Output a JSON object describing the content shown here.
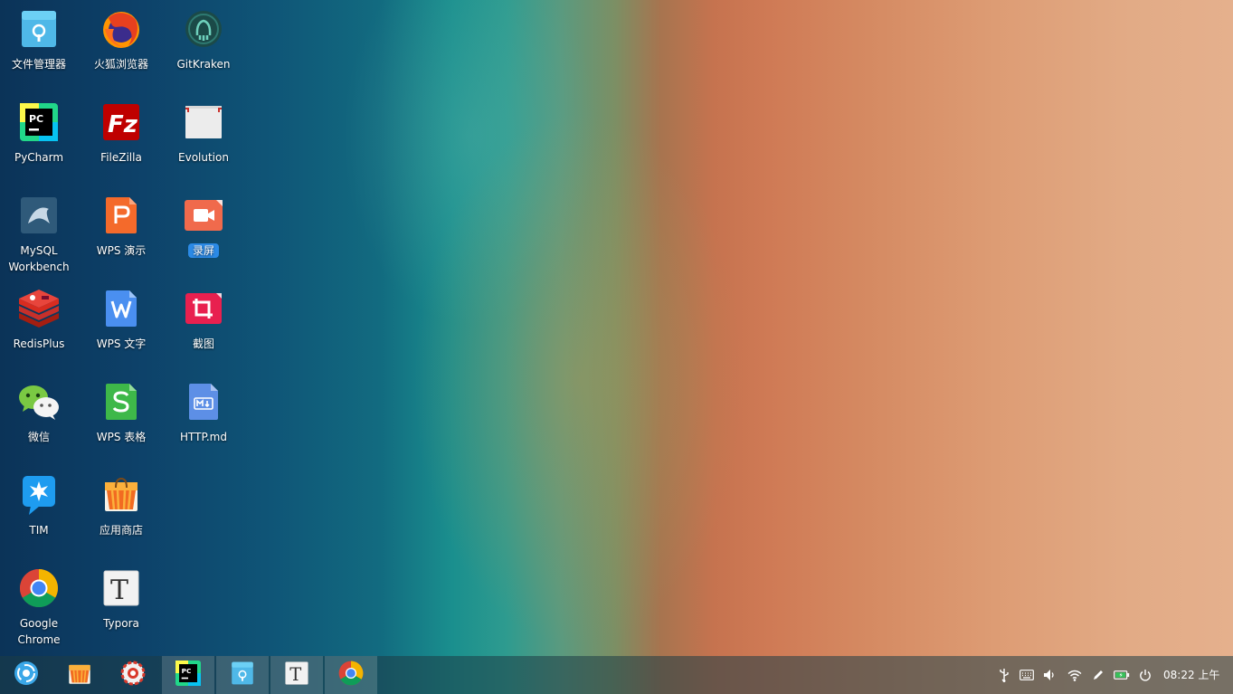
{
  "desktop": {
    "icons": [
      {
        "label": "文件管理器",
        "icon": "file-manager-icon"
      },
      {
        "label": "PyCharm",
        "icon": "pycharm-icon"
      },
      {
        "label": "MySQL Workbench",
        "icon": "mysql-workbench-icon"
      },
      {
        "label": "RedisPlus",
        "icon": "redisplus-icon"
      },
      {
        "label": "微信",
        "icon": "wechat-icon"
      },
      {
        "label": "TIM",
        "icon": "tim-icon"
      },
      {
        "label": "Google Chrome",
        "icon": "chrome-icon"
      },
      {
        "label": "火狐浏览器",
        "icon": "firefox-icon"
      },
      {
        "label": "FileZilla",
        "icon": "filezilla-icon"
      },
      {
        "label": "WPS 演示",
        "icon": "wps-presentation-icon"
      },
      {
        "label": "WPS 文字",
        "icon": "wps-writer-icon"
      },
      {
        "label": "WPS 表格",
        "icon": "wps-spreadsheet-icon"
      },
      {
        "label": "应用商店",
        "icon": "app-store-icon"
      },
      {
        "label": "Typora",
        "icon": "typora-icon"
      },
      {
        "label": "GitKraken",
        "icon": "gitkraken-icon"
      },
      {
        "label": "Evolution",
        "icon": "evolution-icon"
      },
      {
        "label": "录屏",
        "icon": "screen-recorder-icon"
      },
      {
        "label": "截图",
        "icon": "screenshot-icon"
      },
      {
        "label": "HTTP.md",
        "icon": "markdown-file-icon"
      }
    ]
  },
  "taskbar": {
    "items": [
      {
        "icon": "launcher-icon"
      },
      {
        "icon": "app-store-icon"
      },
      {
        "icon": "settings-icon"
      },
      {
        "icon": "pycharm-icon"
      },
      {
        "icon": "file-manager-icon"
      },
      {
        "icon": "typora-icon"
      },
      {
        "icon": "chrome-icon"
      }
    ],
    "tray": [
      "usb-icon",
      "keyboard-icon",
      "volume-icon",
      "wifi-icon",
      "pen-icon",
      "battery-icon",
      "power-icon"
    ],
    "clock": "08:22 上午"
  },
  "colors": {
    "accent": "#2b8ae6",
    "taskbar": "#1e3c46"
  }
}
